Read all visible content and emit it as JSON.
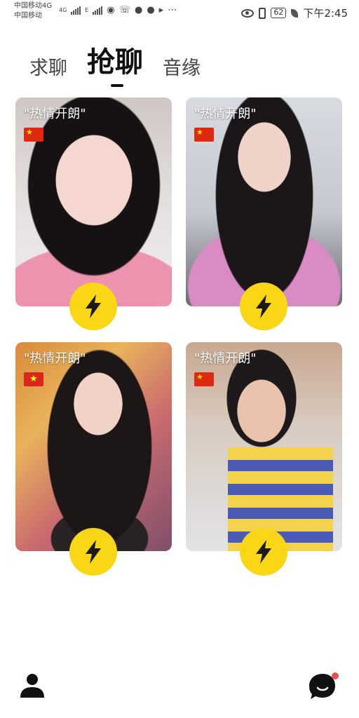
{
  "status_bar": {
    "carrier1": "中国移动4G",
    "carrier2": "中国移动",
    "net1": "4G",
    "net2": "E",
    "battery": "62",
    "time": "下午2:45"
  },
  "tabs": [
    {
      "label": "求聊",
      "active": false
    },
    {
      "label": "抢聊",
      "active": true
    },
    {
      "label": "音缘",
      "active": false
    }
  ],
  "cards": [
    {
      "tag": "\"热情开朗\"",
      "flag": "china-flag-icon"
    },
    {
      "tag": "\"热情开朗\"",
      "flag": "china-flag-icon"
    },
    {
      "tag": "\"热情开朗\"",
      "flag": "vietnam-flag-icon"
    },
    {
      "tag": "\"热情开朗\"",
      "flag": "china-flag-icon"
    }
  ],
  "colors": {
    "accent_yellow": "#f9d616",
    "notification_dot": "#f24b4b"
  }
}
